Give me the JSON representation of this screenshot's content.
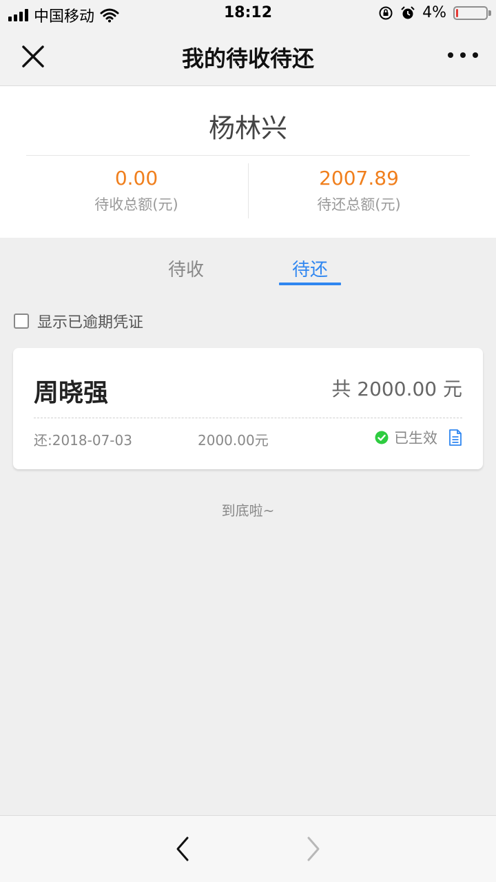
{
  "status_bar": {
    "carrier": "中国移动",
    "time": "18:12",
    "battery_percent": "4%",
    "battery_level": 0.04
  },
  "nav": {
    "title": "我的待收待还"
  },
  "summary": {
    "name": "杨林兴",
    "receivable_amount": "0.00",
    "receivable_label": "待收总额(元)",
    "payable_amount": "2007.89",
    "payable_label": "待还总额(元)",
    "amount_color": "#f07f1d"
  },
  "tabs": [
    {
      "label": "待收",
      "active": false
    },
    {
      "label": "待还",
      "active": true
    }
  ],
  "accent_color": "#2f86f0",
  "filter": {
    "label": "显示已逾期凭证",
    "checked": false
  },
  "records": [
    {
      "name": "周晓强",
      "total": "共 2000.00 元",
      "date": "还:2018-07-03",
      "amount": "2000.00元",
      "status": "已生效",
      "status_color": "#2ecc40",
      "status_icon": "check-circle-icon",
      "document_icon": "document-icon"
    }
  ],
  "end_text": "到底啦~"
}
